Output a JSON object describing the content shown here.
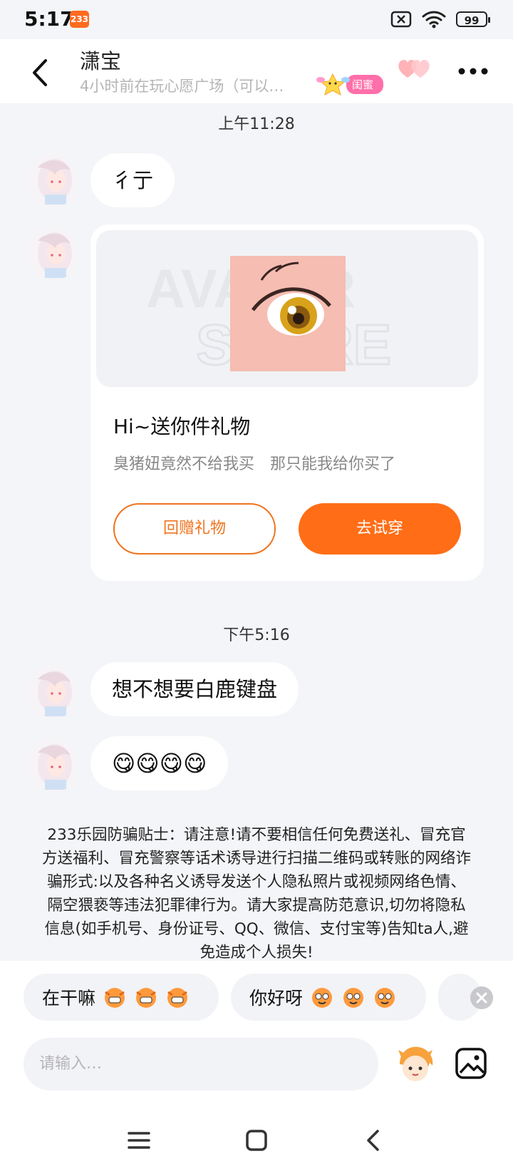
{
  "status_bar": {
    "time": "5:17",
    "app_badge": "233",
    "battery": "99"
  },
  "header": {
    "title": "潇宝",
    "subtitle": "4小时前在玩心愿广场（可以…",
    "badge_label": "闺蜜"
  },
  "chat": {
    "timestamp1": "上午11:28",
    "msg1": "彳亍",
    "gift_card": {
      "image_text": "AVATAR STORE",
      "title": "Hi~送你件礼物",
      "desc": "臭猪妞竟然不给我买　那只能我给你买了",
      "return_button": "回赠礼物",
      "try_button": "去试穿"
    },
    "timestamp2": "下午5:16",
    "msg2": "想不想要白鹿键盘",
    "msg3_emoji": "😋😋😋😋"
  },
  "notice": "233乐园防骗贴士：请注意!请不要相信任何免费送礼、冒充官方送福利、冒充警察等话术诱导进行扫描二维码或转账的网络诈骗形式:以及各种名义诱导发送个人隐私照片或视频网络色情、隔空猥亵等违法犯罪律行为。请大家提高防范意识,切勿将隐私信息(如手机号、身份证号、QQ、微信、支付宝等)告知ta人,避免造成个人损失!",
  "quick_replies": [
    "在干嘛",
    "你好呀"
  ],
  "input": {
    "placeholder": "请输入…"
  },
  "colors": {
    "accent": "#ff6e16",
    "badge_pink": "#ff6fa9",
    "background": "#f4f5f8"
  }
}
